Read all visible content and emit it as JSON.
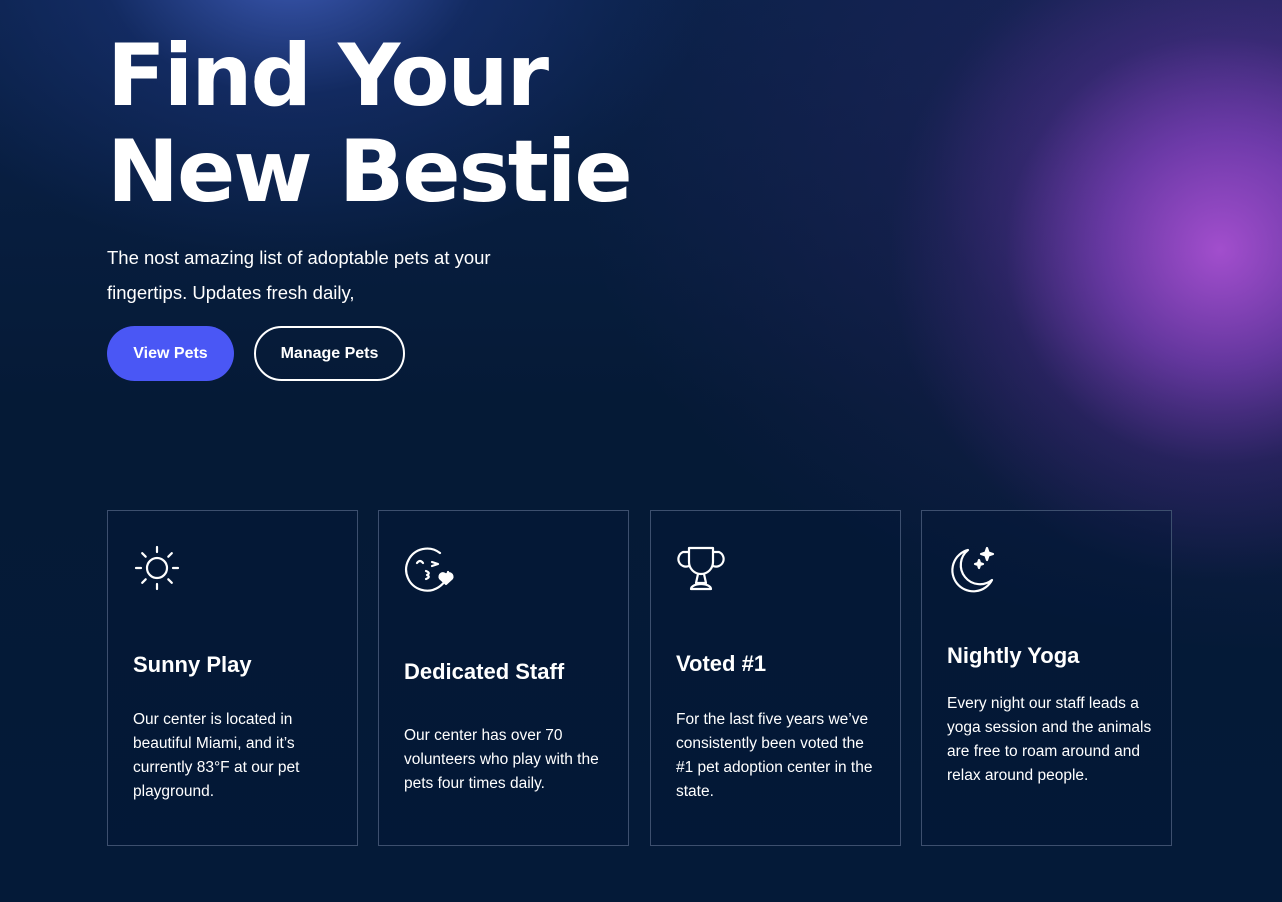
{
  "hero": {
    "title_line1": "Find Your",
    "title_line2": "New Bestie",
    "subtitle": "The nost amazing list of adoptable pets at your fingertips. Updates fresh daily,",
    "primary_button": "View Pets",
    "secondary_button": "Manage Pets"
  },
  "features": [
    {
      "icon": "sun-icon",
      "title": "Sunny Play",
      "description": "Our center is located in beautiful Miami, and it’s currently 83°F at our pet playground."
    },
    {
      "icon": "kiss-wink-heart-icon",
      "title": "Dedicated Staff",
      "description": "Our center has over 70 volunteers who play with the pets four times daily."
    },
    {
      "icon": "trophy-icon",
      "title": "Voted #1",
      "description": "For the last five years we’ve consistently been voted the #1 pet adoption center in the state."
    },
    {
      "icon": "moon-stars-icon",
      "title": "Nightly Yoga",
      "description": "Every night our staff leads a yoga session and the animals are free to roam around and relax around people."
    }
  ],
  "colors": {
    "background": "#051a36",
    "primary_button": "#4a57f5",
    "accent_glow": "#a850d2",
    "card_border": "#3d4f6e"
  }
}
